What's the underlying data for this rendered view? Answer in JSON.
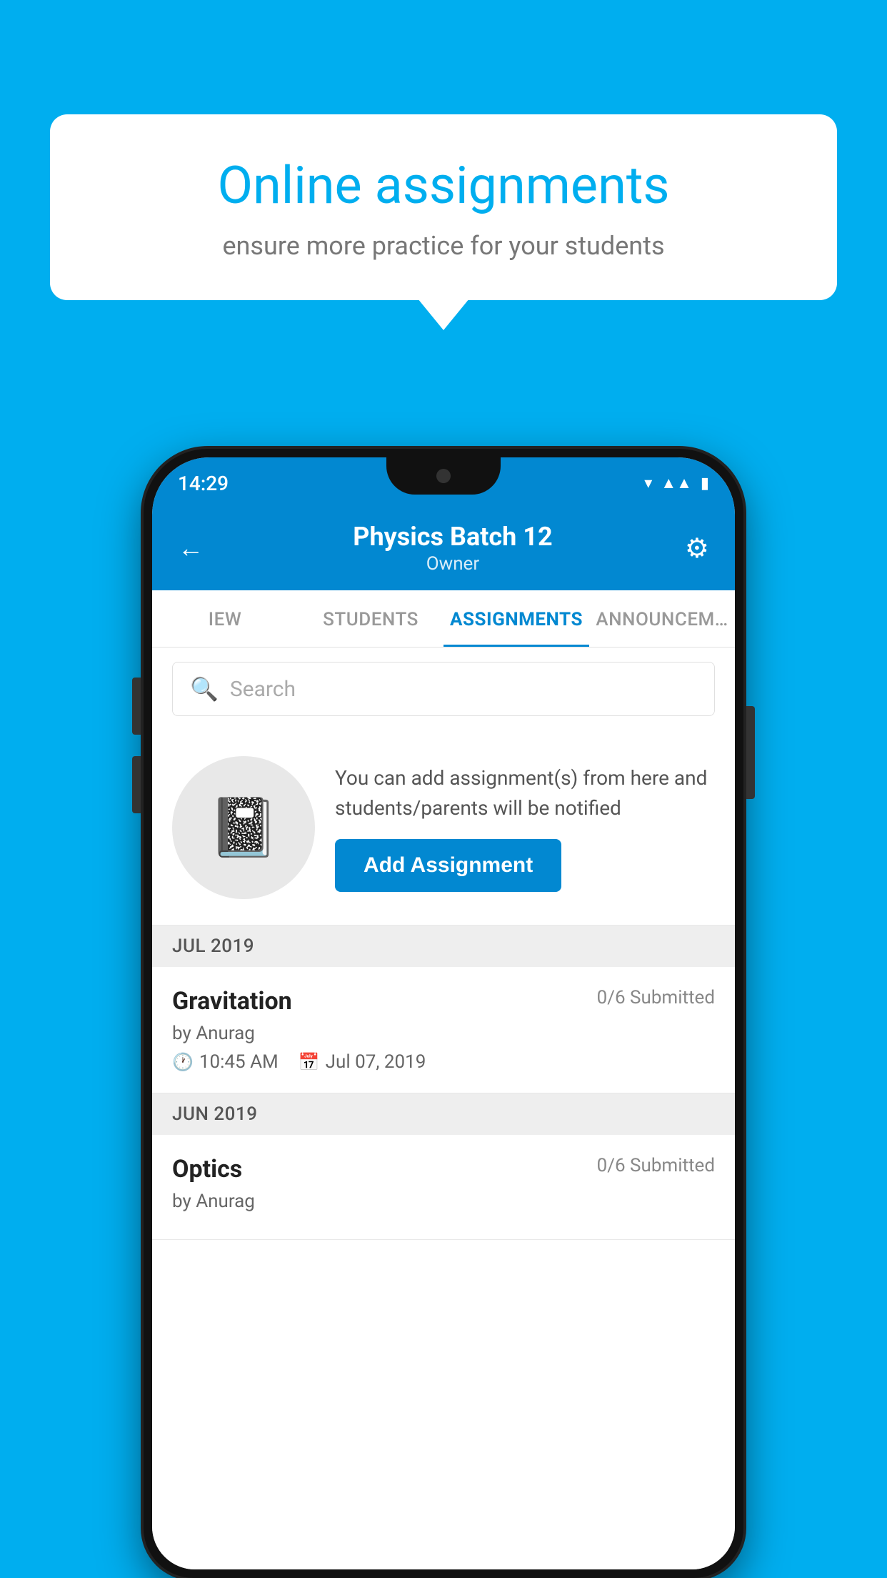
{
  "background_color": "#00AEEF",
  "speech_bubble": {
    "title": "Online assignments",
    "subtitle": "ensure more practice for your students"
  },
  "status_bar": {
    "time": "14:29"
  },
  "app_header": {
    "title": "Physics Batch 12",
    "subtitle": "Owner",
    "back_label": "←",
    "settings_label": "⚙"
  },
  "tabs": [
    {
      "label": "IEW",
      "active": false
    },
    {
      "label": "STUDENTS",
      "active": false
    },
    {
      "label": "ASSIGNMENTS",
      "active": true
    },
    {
      "label": "ANNOUNCEM…",
      "active": false
    }
  ],
  "search": {
    "placeholder": "Search"
  },
  "add_section": {
    "description": "You can add assignment(s) from here and students/parents will be notified",
    "button_label": "Add Assignment"
  },
  "month_groups": [
    {
      "month": "JUL 2019",
      "assignments": [
        {
          "title": "Gravitation",
          "submitted": "0/6 Submitted",
          "by": "by Anurag",
          "time": "10:45 AM",
          "date": "Jul 07, 2019"
        }
      ]
    },
    {
      "month": "JUN 2019",
      "assignments": [
        {
          "title": "Optics",
          "submitted": "0/6 Submitted",
          "by": "by Anurag",
          "time": "",
          "date": ""
        }
      ]
    }
  ]
}
